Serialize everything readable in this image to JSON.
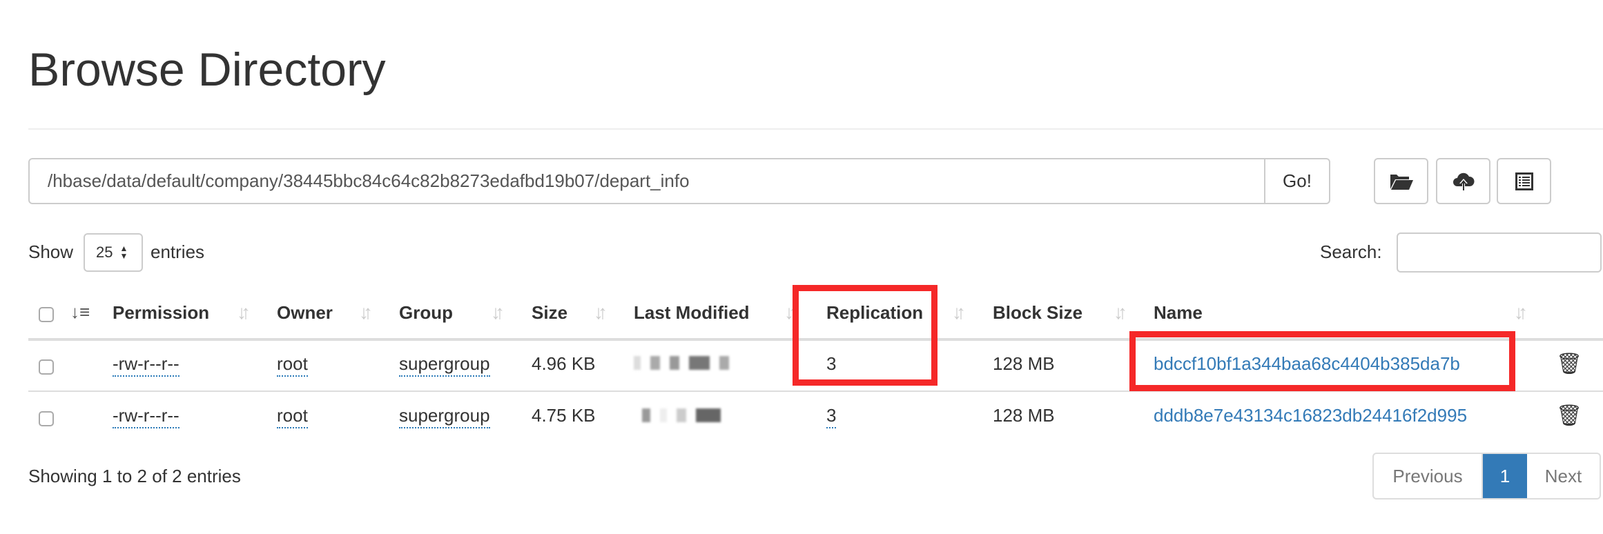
{
  "page": {
    "title": "Browse Directory"
  },
  "path_bar": {
    "value": "/hbase/data/default/company/38445bbc84c64c82b8273edafbd19b07/depart_info",
    "go_label": "Go!"
  },
  "toolbar": {
    "icons": [
      "folder-open-icon",
      "cloud-upload-icon",
      "list-icon"
    ]
  },
  "length": {
    "show_label": "Show",
    "selected": "25",
    "entries_label": "entries"
  },
  "search": {
    "label": "Search:",
    "value": ""
  },
  "table": {
    "columns": [
      "Permission",
      "Owner",
      "Group",
      "Size",
      "Last Modified",
      "Replication",
      "Block Size",
      "Name"
    ],
    "rows": [
      {
        "permission": "-rw-r--r--",
        "owner": "root",
        "group": "supergroup",
        "size": "4.96 KB",
        "replication": "3",
        "block_size": "128 MB",
        "name": "bdccf10bf1a344baa68c4404b385da7b"
      },
      {
        "permission": "-rw-r--r--",
        "owner": "root",
        "group": "supergroup",
        "size": "4.75 KB",
        "replication": "3",
        "block_size": "128 MB",
        "name": "dddb8e7e43134c16823db24416f2d995"
      }
    ]
  },
  "footer": {
    "info": "Showing 1 to 2 of 2 entries",
    "previous": "Previous",
    "current_page": "1",
    "next": "Next"
  },
  "colors": {
    "link": "#337ab7",
    "highlight": "#f52828",
    "active_page": "#337ab7"
  }
}
